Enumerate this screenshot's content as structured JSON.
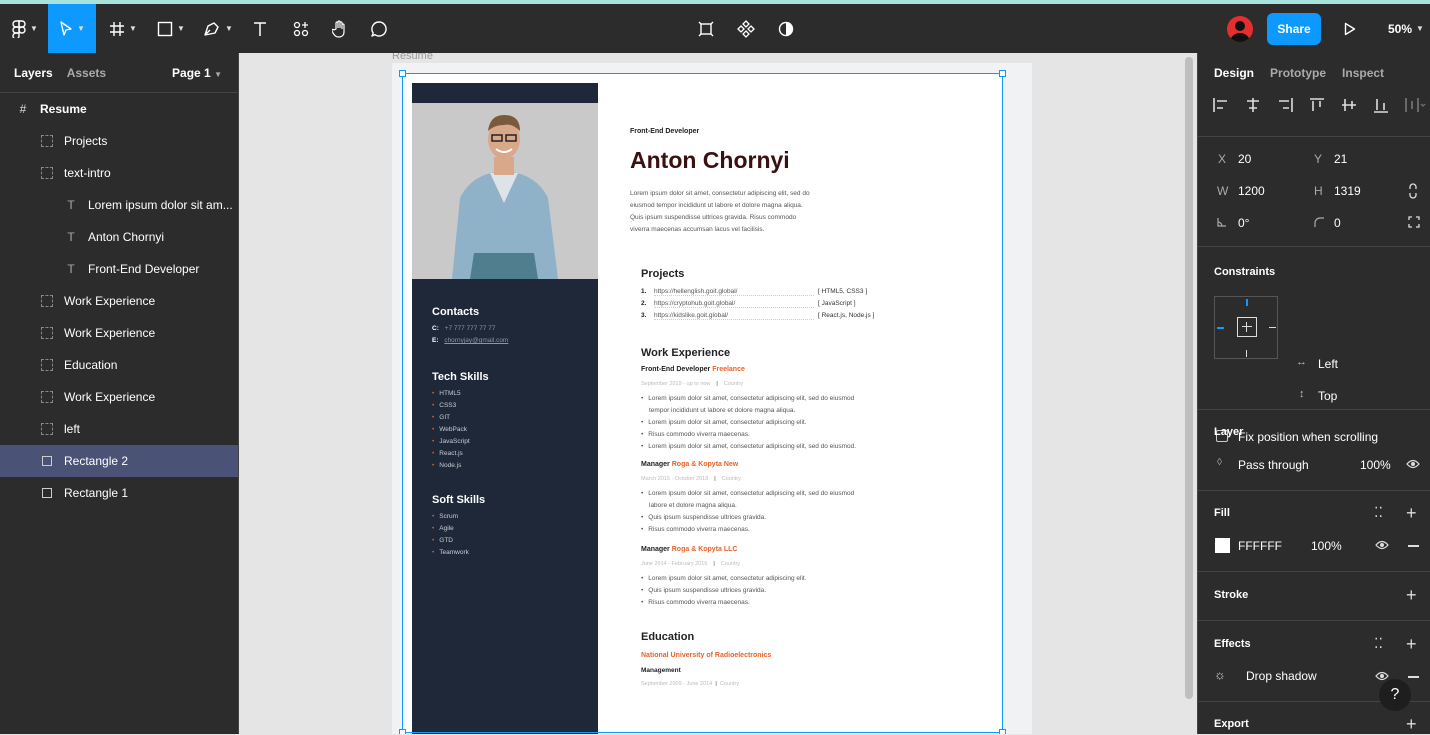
{
  "toolbar": {
    "share_label": "Share",
    "zoom": "50%"
  },
  "left_panel": {
    "tabs": [
      "Layers",
      "Assets"
    ],
    "page_selector": "Page 1",
    "layers": [
      {
        "name": "Resume",
        "type": "frame"
      },
      {
        "name": "Projects",
        "type": "frame"
      },
      {
        "name": "text-intro",
        "type": "frame"
      },
      {
        "name": "Lorem ipsum dolor sit am...",
        "type": "text"
      },
      {
        "name": "Anton Chornyi",
        "type": "text"
      },
      {
        "name": "Front-End Developer",
        "type": "text"
      },
      {
        "name": "Work Experience",
        "type": "frame"
      },
      {
        "name": "Work Experience",
        "type": "frame"
      },
      {
        "name": "Education",
        "type": "frame"
      },
      {
        "name": "Work Experience",
        "type": "frame"
      },
      {
        "name": "left",
        "type": "frame"
      },
      {
        "name": "Rectangle 2",
        "type": "rect",
        "selected": true
      },
      {
        "name": "Rectangle 1",
        "type": "rect"
      }
    ]
  },
  "canvas": {
    "frame_label": "Resume",
    "resume": {
      "role": "Front-End Developer",
      "name": "Anton Chornyi",
      "intro": [
        "Lorem ipsum dolor sit amet, consectetur adipiscing elit, sed do",
        "eiusmod tempor incididunt ut labore et dolore magna aliqua.",
        "Quis ipsum suspendisse ultrices gravida. Risus commodo",
        "viverra maecenas accumsan lacus vel facilisis."
      ],
      "contacts_title": "Contacts",
      "contacts": [
        {
          "k": "C:",
          "v": "+7 777 777 77 77"
        },
        {
          "k": "E:",
          "v": "chornyjay@gmail.com"
        }
      ],
      "tech_title": "Tech Skills",
      "tech": [
        "HTML5",
        "CSS3",
        "GIT",
        "WebPack",
        "JavaScript",
        "React.js",
        "Node.js"
      ],
      "soft_title": "Soft Skills",
      "soft": [
        "Scrum",
        "Agile",
        "GTD",
        "Teamwork"
      ],
      "projects_title": "Projects",
      "projects": [
        {
          "n": "1.",
          "url": "https://hellenglish.goit.global/",
          "tags": "[ HTML5, CSS3 ]"
        },
        {
          "n": "2.",
          "url": "https://cryptohub.goit.global/",
          "tags": "[ JavaScript ]"
        },
        {
          "n": "3.",
          "url": "https://kidslike.goit.global/",
          "tags": "[ React.js, Node.js ]"
        }
      ],
      "work_title": "Work Experience",
      "jobs": [
        {
          "role": "Front-End Developer",
          "company": "Freelance",
          "dates": "September 2019 - up to now",
          "place": "Country",
          "bullets": [
            "Lorem ipsum dolor sit amet, consectetur adipiscing elit, sed do eiusmod",
            "tempor incididunt ut labore et dolore magna aliqua.",
            "Lorem ipsum dolor sit amet, consectetur adipiscing elit.",
            "Risus commodo viverra maecenas.",
            "Lorem ipsum dolor sit amet, consectetur adipiscing elit, sed do eiusmod."
          ]
        },
        {
          "role": "Manager",
          "company": "Roga & Kopyta New",
          "dates": "March 2015 - October 2018",
          "place": "Country",
          "bullets": [
            "Lorem ipsum dolor sit amet, consectetur adipiscing elit, sed do eiusmod",
            "labore et dolore magna aliqua.",
            "Quis ipsum suspendisse ultrices gravida.",
            "Risus commodo viverra maecenas."
          ]
        },
        {
          "role": "Manager",
          "company": "Roga & Kopyta LLC",
          "dates": "June 2014 - February 2015",
          "place": "Country",
          "bullets": [
            "Lorem ipsum dolor sit amet, consectetur adipiscing elit.",
            "Quis ipsum suspendisse ultrices gravida.",
            "Risus commodo viverra maecenas."
          ]
        }
      ],
      "edu_title": "Education",
      "edu_school": "National University of Radioelectronics",
      "edu_degree": "Management",
      "edu_dates": "September 2009 - June 2014",
      "edu_place": "Country"
    }
  },
  "right_panel": {
    "tabs": [
      "Design",
      "Prototype",
      "Inspect"
    ],
    "x_label": "X",
    "x": "20",
    "y_label": "Y",
    "y": "21",
    "w_label": "W",
    "w": "1200",
    "h_label": "H",
    "h": "1319",
    "rotation": "0°",
    "radius": "0",
    "constraints_title": "Constraints",
    "constraint_h": "Left",
    "constraint_v": "Top",
    "fix_position_label": "Fix position when scrolling",
    "layer_title": "Layer",
    "blend_mode": "Pass through",
    "layer_opacity": "100%",
    "fill_title": "Fill",
    "fill_hex": "FFFFFF",
    "fill_opacity": "100%",
    "stroke_title": "Stroke",
    "effects_title": "Effects",
    "effect": "Drop shadow",
    "export_title": "Export",
    "help": "?"
  },
  "colors": {
    "accent": "#0d99ff",
    "sidebar": "#1e2838",
    "orange": "#e8622a",
    "name": "#3a1010"
  }
}
